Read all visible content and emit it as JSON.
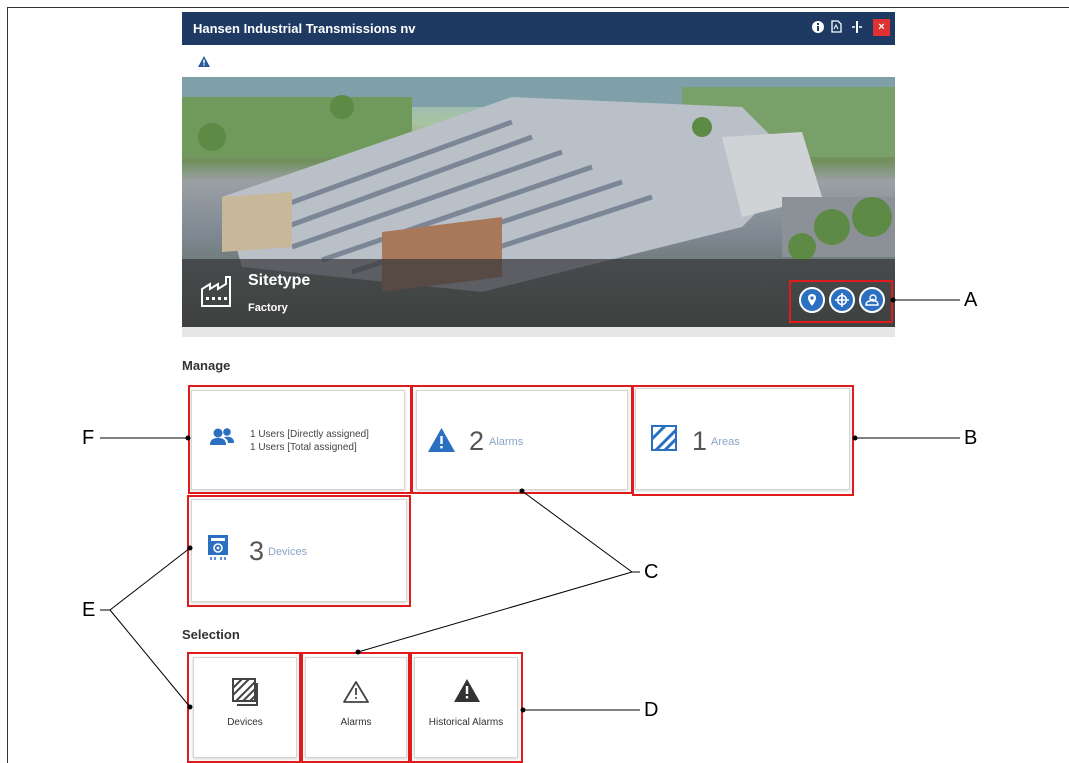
{
  "window": {
    "title": "Hansen Industrial Transmissions nv",
    "close_label": "×"
  },
  "site": {
    "type_label": "Sitetype",
    "type_value": "Factory"
  },
  "manage": {
    "heading": "Manage",
    "users": {
      "line1": "1 Users [Directly assigned]",
      "line2": "1 Users [Total assigned]"
    },
    "alarms": {
      "count": "2",
      "label": "Alarms"
    },
    "areas": {
      "count": "1",
      "label": "Areas"
    },
    "devices": {
      "count": "3",
      "label": "Devices"
    }
  },
  "selection": {
    "heading": "Selection",
    "items": [
      {
        "label": "Devices",
        "icon": "devices-hatched-icon"
      },
      {
        "label": "Alarms",
        "icon": "alarm-outline-icon"
      },
      {
        "label": "Historical Alarms",
        "icon": "alarm-filled-icon"
      }
    ]
  },
  "callouts": [
    "A",
    "B",
    "C",
    "D",
    "E",
    "F"
  ],
  "colors": {
    "titlebar": "#1e3a63",
    "accent": "#2a6fc0",
    "callout": "#e01b1b",
    "close": "#e03232"
  }
}
